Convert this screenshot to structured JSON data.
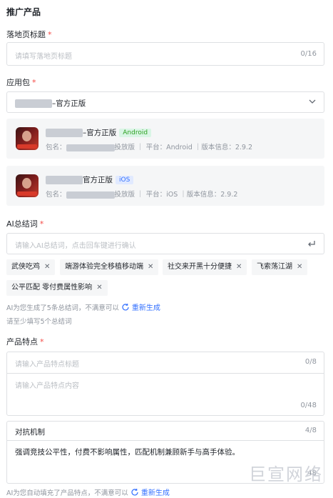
{
  "section_title": "推广产品",
  "landing_title": {
    "label": "落地页标题",
    "placeholder": "请填写落地页标题",
    "count": "0/16"
  },
  "app_package": {
    "label": "应用包",
    "selected": "–官方正版",
    "apps": [
      {
        "name_suffix": "–官方正版",
        "platform_badge": "Android",
        "pkg_label": "包名：",
        "pkg_suffix": "投放版",
        "meta": "平台：Android ｜版本信息：2.9.2"
      },
      {
        "name_suffix": "官方正版",
        "platform_badge": "iOS",
        "pkg_label": "包名：",
        "pkg_suffix": "投放版",
        "meta": "平台：iOS ｜版本信息：2.9.2"
      }
    ]
  },
  "ai_keywords": {
    "label": "AI总结词",
    "placeholder": "请输入AI总结词，点击回车键进行确认",
    "tags": [
      "武侠吃鸡",
      "端游体验完全移植移动端",
      "社交来开黑十分便捷",
      "飞索荡江湖",
      "公平匹配  零付费属性影响"
    ],
    "hint": "AI为您生成了5条总结词，不满意可以",
    "regenerate": "重新生成",
    "min_hint": "请至少填写5个总结词"
  },
  "features": {
    "label": "产品特点",
    "empty_title_placeholder": "请输入产品特点标题",
    "empty_title_count": "0/8",
    "empty_content_placeholder": "请输入产品特点内容",
    "empty_content_count": "0/48",
    "filled_title": "对抗机制",
    "filled_title_count": "4/8",
    "filled_content": "强调竞技公平性，付费不影响属性，匹配机制兼顾新手与高手体验。",
    "filled_content_count": "48",
    "hint": "AI为您自动填充了产品特点，不满意可以",
    "regenerate": "重新生成"
  },
  "watermark": "巨宣网络"
}
